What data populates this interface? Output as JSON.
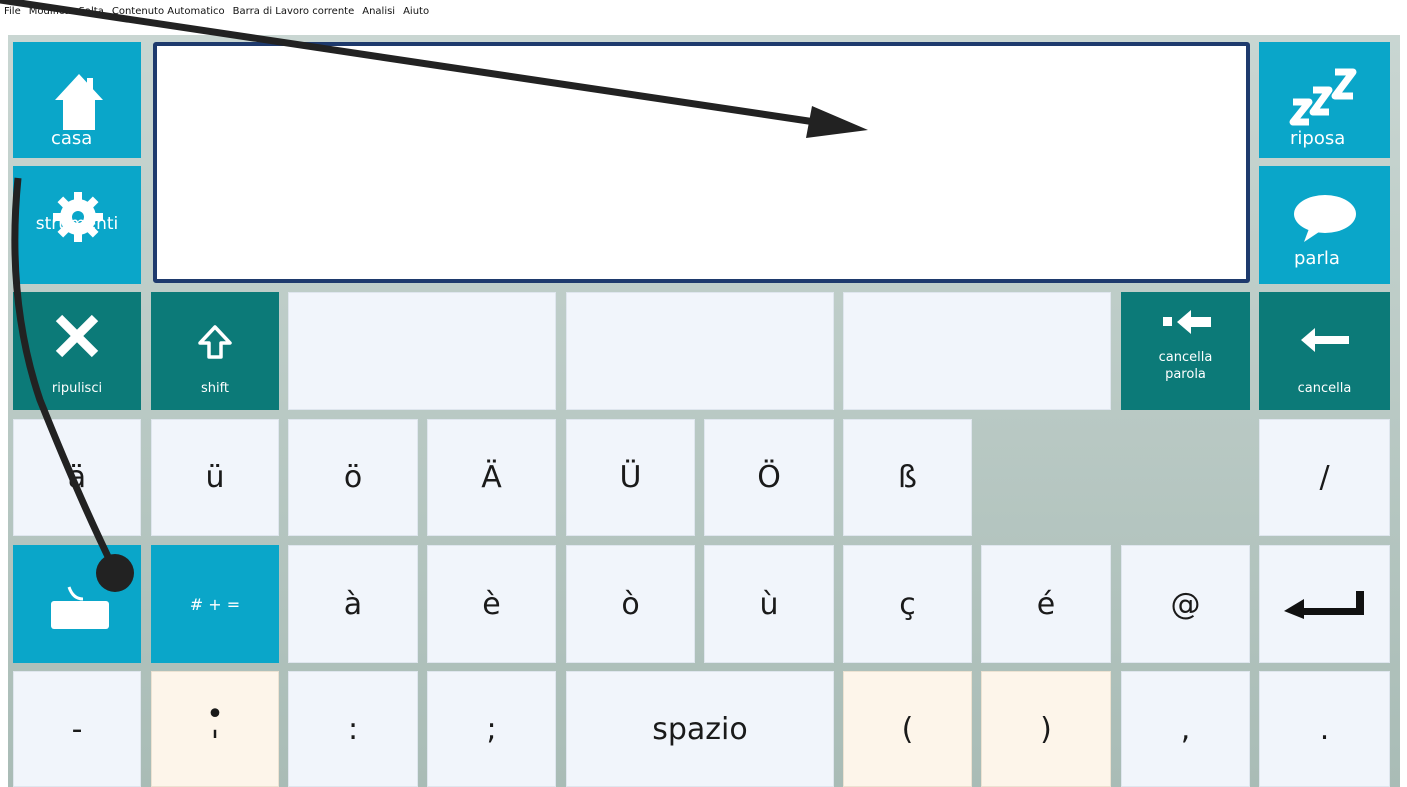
{
  "menu": [
    "File",
    "Modifica",
    "Salta",
    "Contenuto Automatico",
    "Barra di Lavoro corrente",
    "Analisi",
    "Aiuto"
  ],
  "top_left": {
    "home": "casa",
    "tools": "strumenti"
  },
  "top_right": {
    "rest": "riposa",
    "speak": "parla"
  },
  "text_field": {
    "value": ""
  },
  "row3": {
    "clear": "ripulisci",
    "shift": "shift",
    "delete_word_1": "cancella",
    "delete_word_2": "parola",
    "delete": "cancella"
  },
  "row4": [
    "ä",
    "ü",
    "ö",
    "Ä",
    "Ü",
    "Ö",
    "ß",
    "/"
  ],
  "row5": {
    "symbols": "# + =",
    "letters": [
      "à",
      "è",
      "ò",
      "ù",
      "ç",
      "é",
      "@"
    ]
  },
  "row6": {
    "dash": "-",
    "semicolon_top": "•",
    "semicolon_bottom": "'",
    "colon": ":",
    "semicolon": ";",
    "space": "spazio",
    "lparen": "(",
    "rparen": ")",
    "comma": ",",
    "period": "."
  },
  "colors": {
    "blue": "#0aa6c9",
    "teal": "#0c7a78",
    "key_white": "#f1f5fb",
    "key_cream": "#fdf5ea",
    "frame": "#1e3a6d"
  }
}
